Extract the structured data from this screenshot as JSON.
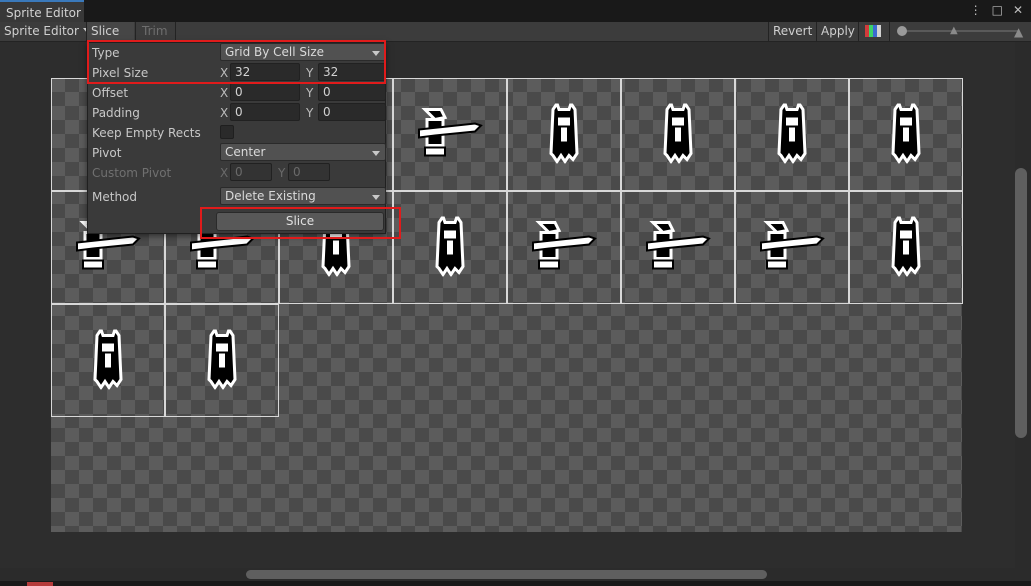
{
  "window": {
    "tab_title": "Sprite Editor"
  },
  "toolbar": {
    "mode_label": "Sprite Editor",
    "slice_label": "Slice",
    "trim_label": "Trim",
    "revert_label": "Revert",
    "apply_label": "Apply"
  },
  "slice_popup": {
    "type": {
      "label": "Type",
      "value": "Grid By Cell Size"
    },
    "pixel_size": {
      "label": "Pixel Size",
      "x_axis": "X",
      "x": "32",
      "y_axis": "Y",
      "y": "32"
    },
    "offset": {
      "label": "Offset",
      "x_axis": "X",
      "x": "0",
      "y_axis": "Y",
      "y": "0"
    },
    "padding": {
      "label": "Padding",
      "x_axis": "X",
      "x": "0",
      "y_axis": "Y",
      "y": "0"
    },
    "keep_empty": {
      "label": "Keep Empty Rects",
      "checked": false
    },
    "pivot": {
      "label": "Pivot",
      "value": "Center"
    },
    "custom_pivot": {
      "label": "Custom Pivot",
      "x_axis": "X",
      "x": "0",
      "y_axis": "Y",
      "y": "0"
    },
    "method": {
      "label": "Method",
      "value": "Delete Existing"
    },
    "slice_button": "Slice"
  },
  "icons": {
    "kebab": "⋮",
    "maximize": "□",
    "close": "✕"
  },
  "colors": {
    "highlight": "#e01b1b",
    "tab_accent": "#3a79bb"
  }
}
